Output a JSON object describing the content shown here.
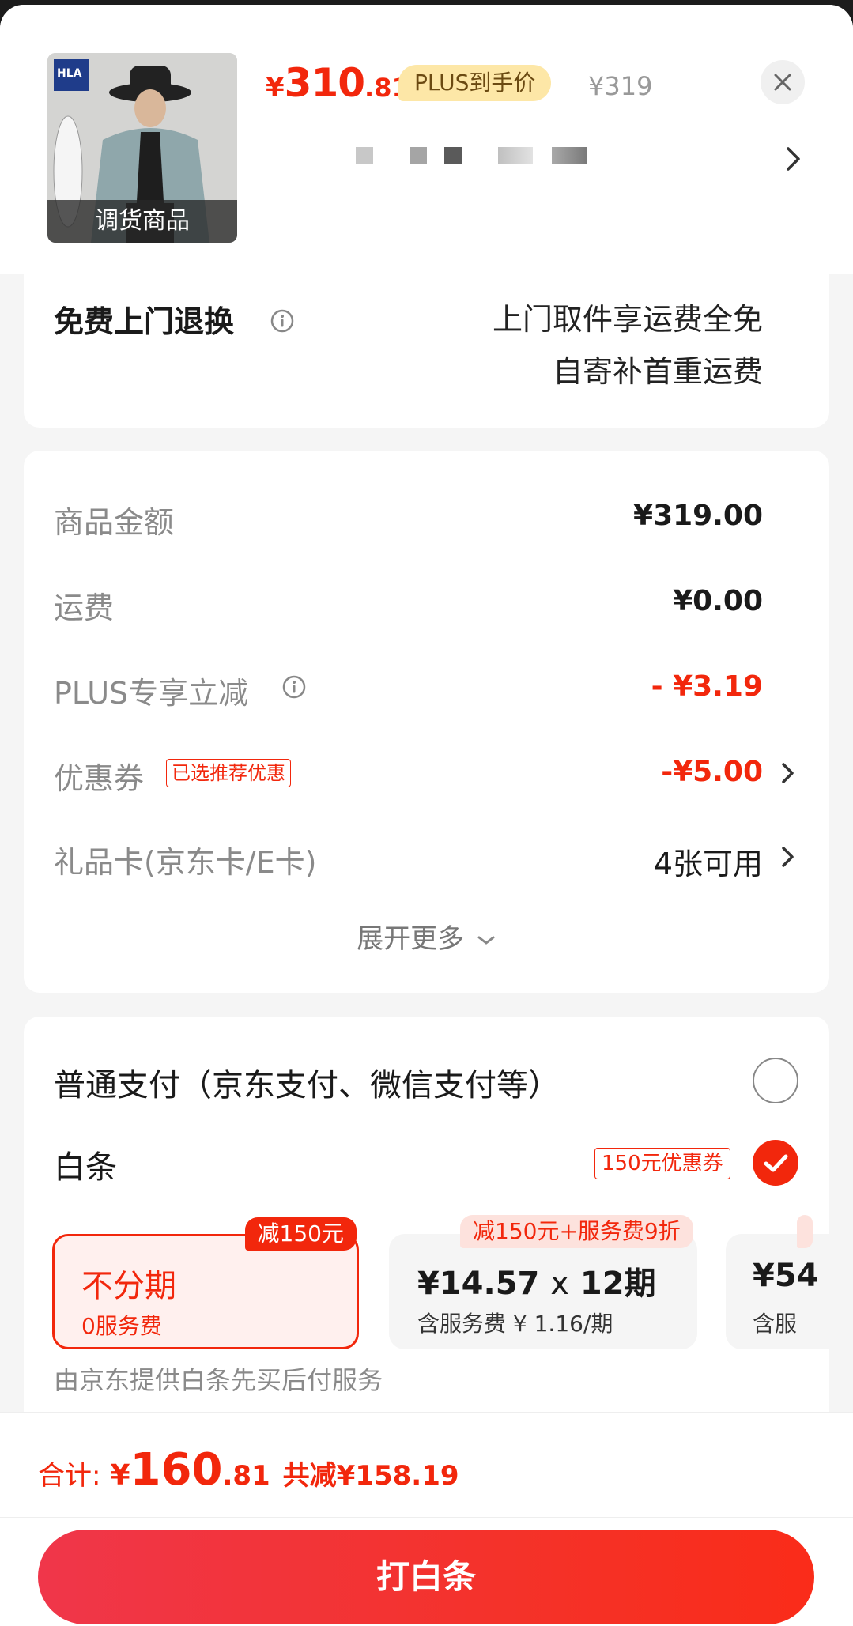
{
  "product": {
    "thumb_brand": "HLA",
    "thumb_caption": "调货商品",
    "price_currency": "¥",
    "price_integer": "310",
    "price_decimal": ".81",
    "plus_tag": "PLUS到手价",
    "original_price": "¥319"
  },
  "returns": {
    "title": "免费上门退换",
    "line1": "上门取件享运费全免",
    "line2": "自寄补首重运费"
  },
  "amounts": {
    "goods_label": "商品金额",
    "goods_value": "¥319.00",
    "shipping_label": "运费",
    "shipping_value": "¥0.00",
    "plus_label": "PLUS专享立减",
    "plus_value": "- ¥3.19",
    "coupon_label": "优惠券",
    "coupon_tag": "已选推荐优惠",
    "coupon_value": "-¥5.00",
    "giftcard_label": "礼品卡(京东卡/E卡)",
    "giftcard_value": "4张可用",
    "expand_more": "展开更多"
  },
  "payment": {
    "normal_label": "普通支付（京东支付、微信支付等）",
    "baitiao_label": "白条",
    "baitiao_coupon": "150元优惠券",
    "plans": [
      {
        "badge": "减150元",
        "title": "不分期",
        "sub": "0服务费"
      },
      {
        "badge": "减150元+服务费9折",
        "title_amount": "¥14.57",
        "title_x": "x",
        "title_periods": "12期",
        "sub": "含服务费 ¥ 1.16/期"
      },
      {
        "badge": "",
        "title": "¥54",
        "sub": "含服"
      }
    ],
    "note": "由京东提供白条先买后付服务"
  },
  "footer": {
    "total_label": "合计:",
    "total_currency": "¥",
    "total_integer": "160",
    "total_decimal": ".81",
    "total_saved": "共减¥158.19",
    "cta_label": "打白条"
  },
  "colors": {
    "accent": "#f2270c",
    "plus_gold": "#fde7a7"
  }
}
